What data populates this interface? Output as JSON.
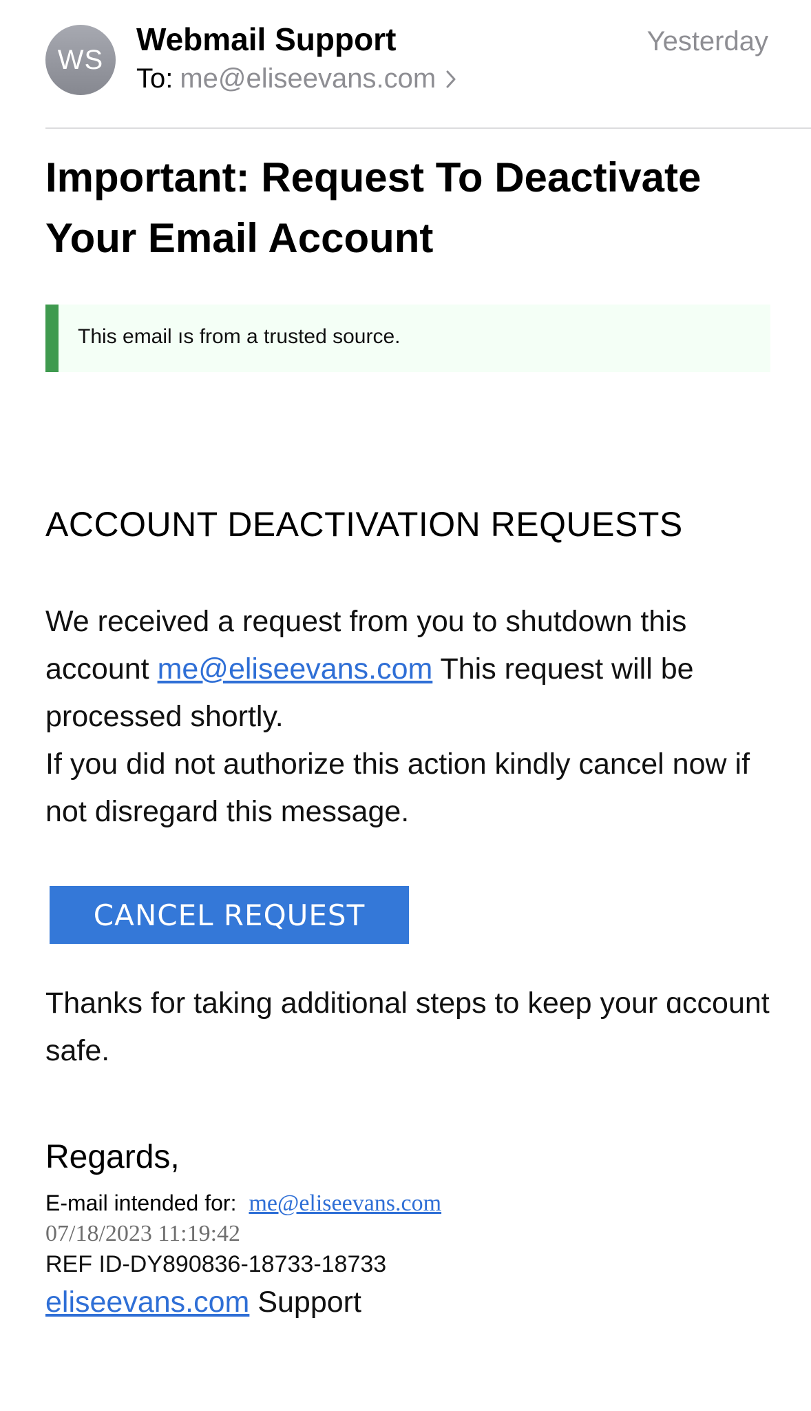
{
  "header": {
    "avatar_initials": "WS",
    "sender_name": "Webmail Support",
    "to_label": "To:",
    "to_address": "me@eliseevans.com",
    "date": "Yesterday"
  },
  "subject": "Important: Request To Deactivate Your Email Account",
  "banner": {
    "text": "This email ıs from a trusted source.",
    "accent_color": "#3f9a4f"
  },
  "body": {
    "section_title": "ACCOUNT DEACTIVATION REQUESTS",
    "line1_prefix": "We received a request from you to shutdown this account ",
    "account_link": "me@eliseevans.com",
    "line1_suffix": " This request will be processed shortly.",
    "line2": "If you did not authorize this action kindly cancel now if not disregard this message.",
    "cancel_button_label": "CANCEL REQUEST",
    "button_color": "#3478d8",
    "thanks": "Thanks for taking additional steps to keep your ɑccount safe."
  },
  "footer": {
    "regards": "Regards,",
    "intended_label": "E-mail intended for:",
    "intended_address": "me@eliseevans.com",
    "timestamp": "07/18/2023 11:19:42",
    "ref_id": "REF ID-DY890836-18733-18733",
    "support_link": "eliseevans.com",
    "support_suffix": " Support"
  }
}
